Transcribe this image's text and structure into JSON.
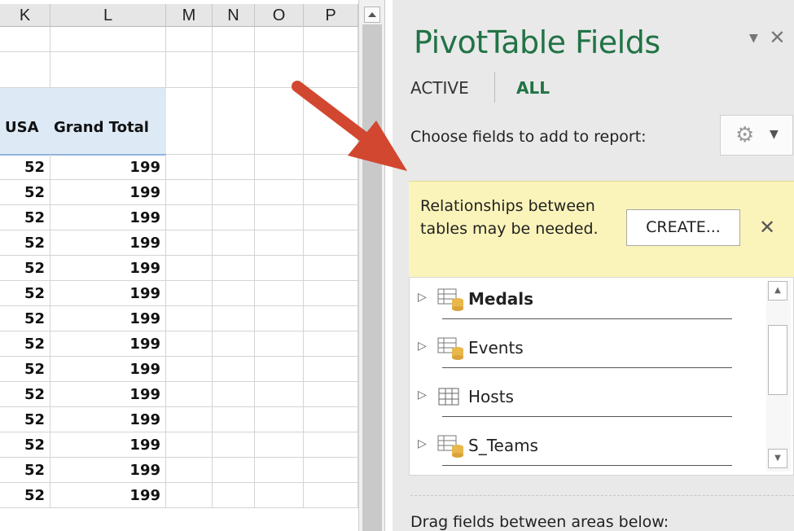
{
  "sheet": {
    "columns": [
      "K",
      "L",
      "M",
      "N",
      "O",
      "P"
    ],
    "pivot_header": {
      "col_k": "USA",
      "col_l": "Grand Total"
    },
    "rows": [
      {
        "k": "52",
        "l": "199"
      },
      {
        "k": "52",
        "l": "199"
      },
      {
        "k": "52",
        "l": "199"
      },
      {
        "k": "52",
        "l": "199"
      },
      {
        "k": "52",
        "l": "199"
      },
      {
        "k": "52",
        "l": "199"
      },
      {
        "k": "52",
        "l": "199"
      },
      {
        "k": "52",
        "l": "199"
      },
      {
        "k": "52",
        "l": "199"
      },
      {
        "k": "52",
        "l": "199"
      },
      {
        "k": "52",
        "l": "199"
      },
      {
        "k": "52",
        "l": "199"
      },
      {
        "k": "52",
        "l": "199"
      },
      {
        "k": "52",
        "l": "199"
      }
    ]
  },
  "pane": {
    "title": "PivotTable Fields",
    "header_icons": {
      "dropdown": "chevron-down-icon",
      "close": "close-icon"
    },
    "tabs": {
      "active": "ACTIVE",
      "all": "ALL"
    },
    "choose_label": "Choose fields to add to report:",
    "settings_icon": "gear-icon",
    "notice": {
      "text": "Relationships between tables may be needed.",
      "create_label": "CREATE...",
      "close_glyph": "✕"
    },
    "tables": [
      {
        "name": "Medals",
        "bold": true,
        "icon": "data-model-table-icon"
      },
      {
        "name": "Events",
        "bold": false,
        "icon": "data-model-table-icon"
      },
      {
        "name": "Hosts",
        "bold": false,
        "icon": "table-icon"
      },
      {
        "name": "S_Teams",
        "bold": false,
        "icon": "data-model-table-icon"
      }
    ],
    "drag_label": "Drag fields between areas below:"
  },
  "colors": {
    "excel_green": "#217346",
    "notice_bg": "#fbf4ba",
    "arrow": "#d2472f",
    "pivot_header_bg": "#dde9f5"
  }
}
